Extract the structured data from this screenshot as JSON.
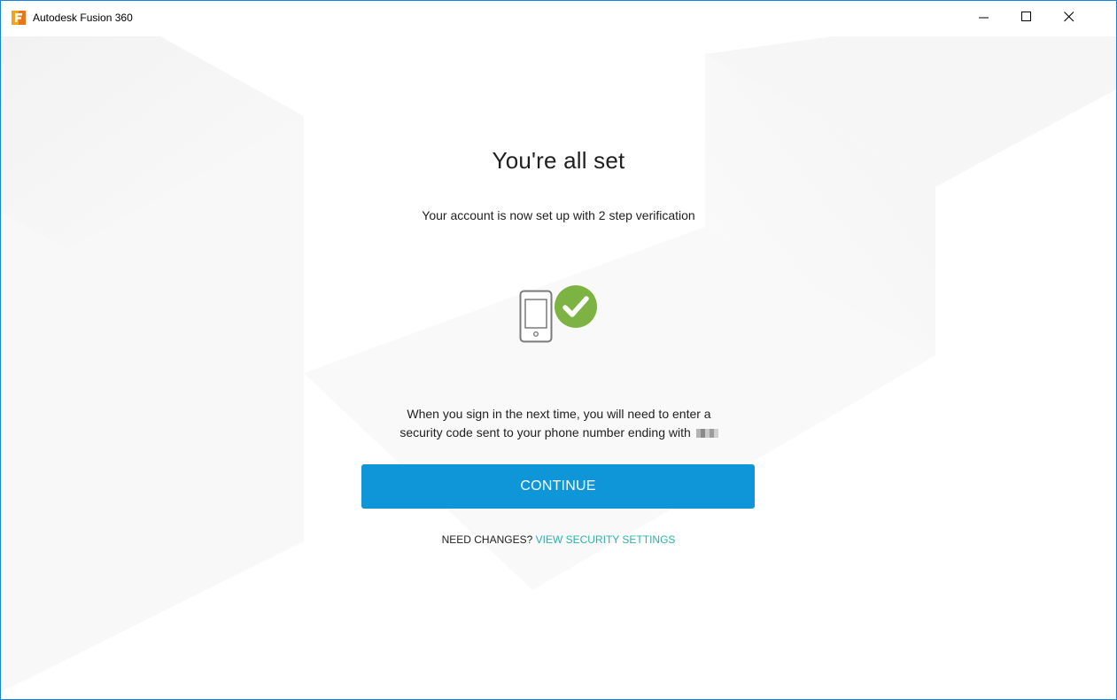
{
  "window": {
    "title": "Autodesk Fusion 360",
    "controls": [
      "minimize-icon",
      "maximize-icon",
      "close-icon"
    ]
  },
  "main": {
    "heading": "You're all set",
    "subheading": "Your account is now set up with 2 step verification",
    "icons": [
      "phone-icon",
      "checkmark-icon"
    ],
    "info_line1": "When you sign in the next time, you will need to enter a",
    "info_line2": "security code sent to your phone number ending with",
    "continue_label": "CONTINUE",
    "changes_prefix": "NEED CHANGES?",
    "changes_link": "VIEW SECURITY SETTINGS"
  },
  "colors": {
    "accent": "#0f96d9",
    "link": "#29b3a7",
    "success": "#7cb342",
    "window_border": "#1883d7"
  }
}
